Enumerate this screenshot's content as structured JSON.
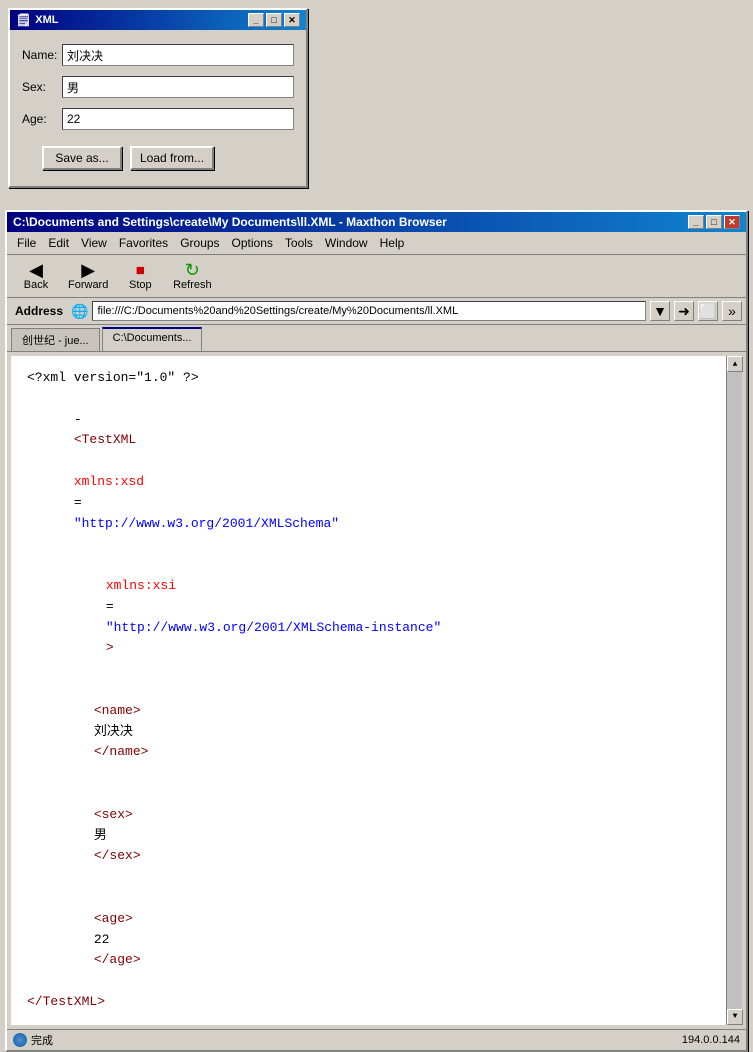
{
  "xml_dialog": {
    "title": "XML",
    "fields": {
      "name_label": "Name:",
      "name_value": "刘决决",
      "sex_label": "Sex:",
      "sex_value": "男",
      "age_label": "Age:",
      "age_value": "22"
    },
    "buttons": {
      "save_label": "Save as...",
      "load_label": "Load from..."
    },
    "controls": {
      "minimize": "_",
      "maximize": "□",
      "close": "✕"
    }
  },
  "browser": {
    "title": "C:\\Documents and Settings\\create\\My Documents\\ll.XML - Maxthon Browser",
    "menubar": [
      "File",
      "Edit",
      "View",
      "Favorites",
      "Groups",
      "Options",
      "Tools",
      "Window",
      "Help"
    ],
    "toolbar": {
      "back_label": "Back",
      "forward_label": "Forward",
      "stop_label": "Stop",
      "refresh_label": "Refresh"
    },
    "address": {
      "label": "Address",
      "url": "file:///C:/Documents%20and%20Settings/create/My%20Documents/ll.XML"
    },
    "tabs": [
      {
        "label": "创世纪 - jue...",
        "active": false
      },
      {
        "label": "C:\\Documents...",
        "active": true
      }
    ],
    "content": {
      "line1": "<?xml version=\"1.0\" ?>",
      "line2_prefix": "- ",
      "line2_tag": "TestXML",
      "line2_attr1_name": "xmlns:xsd",
      "line2_attr1_value": "http://www.w3.org/2001/XMLSchema",
      "line3_attr2_name": "xmlns:xsi",
      "line3_attr2_value": "http://www.w3.org/2001/XMLSchema-instance",
      "line4_name_tag": "name",
      "line4_name_value": "刘决决",
      "line5_sex_tag": "sex",
      "line5_sex_value": "男",
      "line6_age_tag": "age",
      "line6_age_value": "22",
      "line7_close": "/TestXML"
    },
    "status": {
      "left": "完成",
      "right": "194.0.0.144"
    }
  }
}
